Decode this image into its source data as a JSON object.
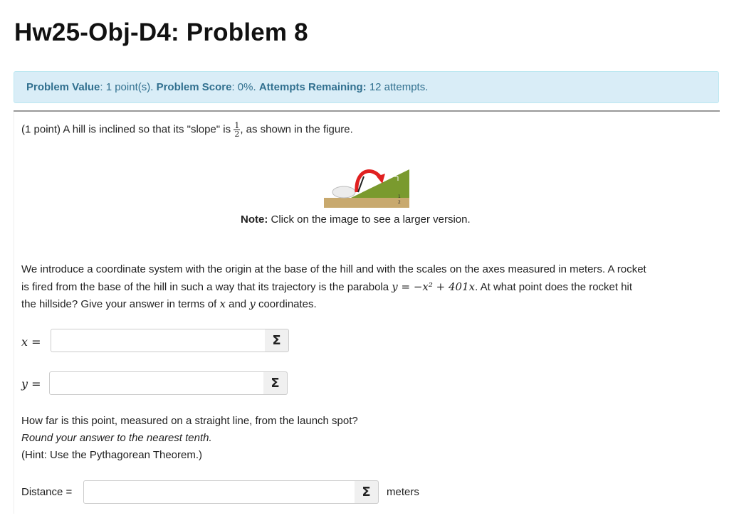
{
  "header": {
    "title": "Hw25-Obj-D4: Problem 8"
  },
  "status": {
    "value_label": "Problem Value",
    "value": ": 1 point(s). ",
    "score_label": "Problem Score",
    "score": ": 0%. ",
    "attempts_label": "Attempts Remaining:",
    "attempts": " 12 attempts."
  },
  "problem": {
    "intro_before": "(1 point) A hill is inclined so that its \"slope\" is",
    "slope_num": "1",
    "slope_den": "2",
    "intro_after": ", as shown in the figure.",
    "note_label": "Note:",
    "note_text": " Click on the image to see a larger version.",
    "body_line1": "We introduce a coordinate system with the origin at the base of the hill and with the scales on the axes measured in meters. A rocket",
    "body_line2_before": "is fired from the base of the hill in such a way that its trajectory is the parabola",
    "body_line2_math": "y = −x² + 401x",
    "body_line2_after": ". At what point does the rocket hit",
    "body_line3_before": "the hillside? Give your answer in terms of",
    "body_line3_x": "x",
    "body_line3_mid": "and",
    "body_line3_y": "y",
    "body_line3_after": "coordinates.",
    "q2_line1": "How far is this point, measured on a straight line, from the launch spot?",
    "q2_line2": "Round your answer to the nearest tenth.",
    "q2_line3": "(Hint: Use the Pythagorean Theorem.)"
  },
  "figure": {
    "label_top": "1",
    "label_bottom": "2",
    "colors": {
      "hill": "#7a9a2e",
      "ground": "#c8a96e",
      "rocket_path": "#e02020"
    }
  },
  "answers": {
    "x_label": "x =",
    "x_value": "",
    "y_label": "y =",
    "y_value": "",
    "distance_label": "Distance =",
    "distance_value": "",
    "distance_unit": "meters",
    "sigma": "Σ"
  }
}
